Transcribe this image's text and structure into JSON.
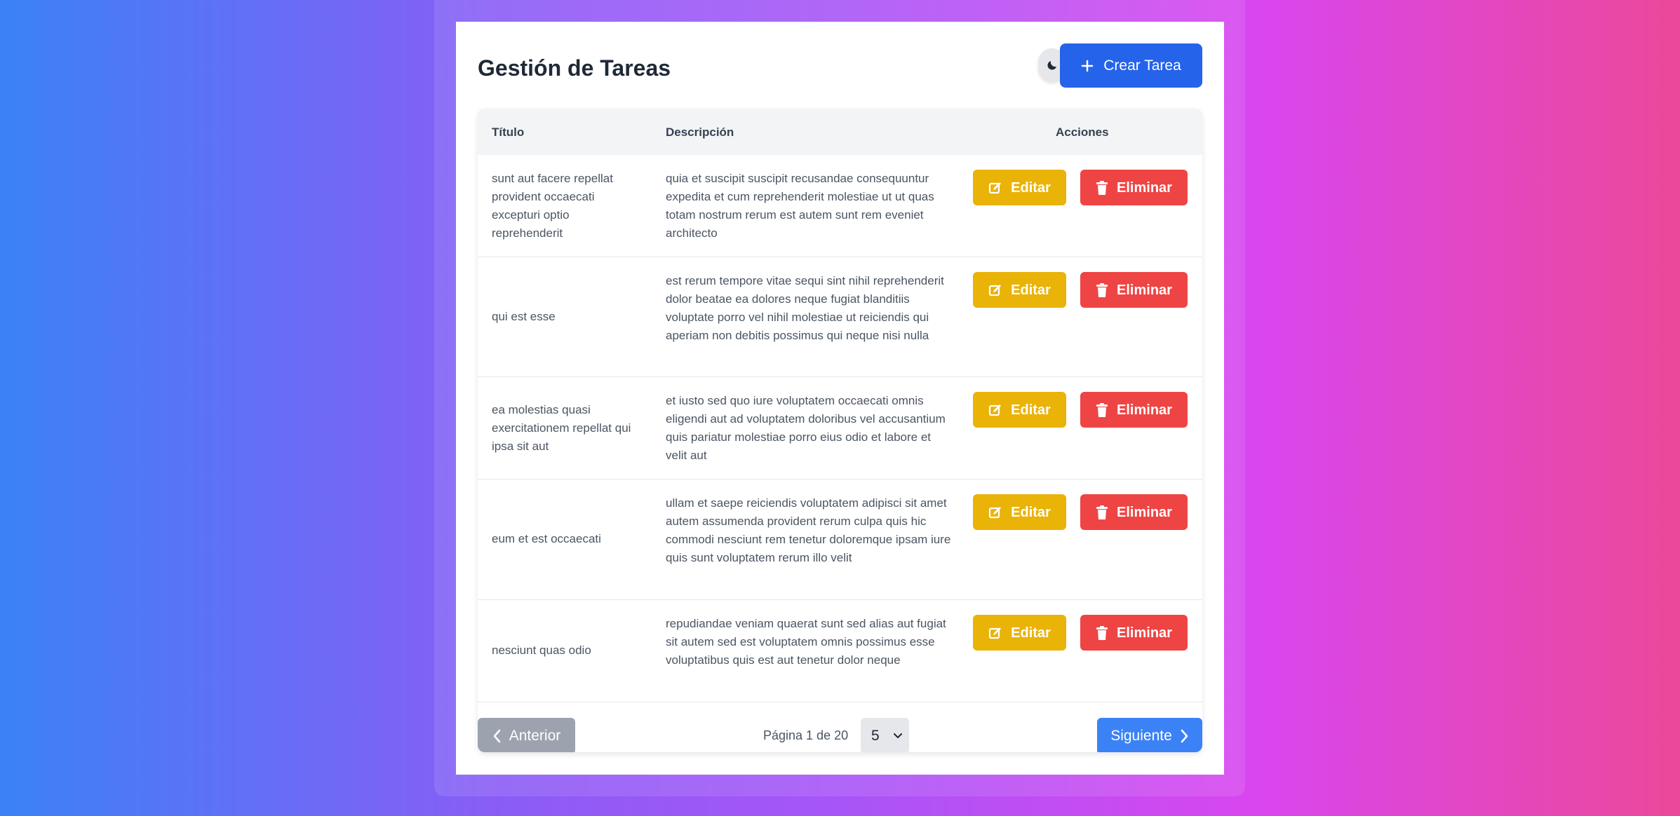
{
  "app": {
    "title": "Gestión de Tareas",
    "create_label": "Crear Tarea",
    "theme_icon": "moon-icon"
  },
  "table": {
    "headers": {
      "title": "Título",
      "description": "Descripción",
      "actions": "Acciones"
    },
    "edit_label": "Editar",
    "delete_label": "Eliminar",
    "rows": [
      {
        "title": "sunt aut facere repellat provident occaecati excepturi optio reprehenderit",
        "description": "quia et suscipit suscipit recusandae consequuntur expedita et cum reprehenderit molestiae ut ut quas totam nostrum rerum est autem sunt rem eveniet architecto"
      },
      {
        "title": "qui est esse",
        "description": "est rerum tempore vitae sequi sint nihil reprehenderit dolor beatae ea dolores neque fugiat blanditiis voluptate porro vel nihil molestiae ut reiciendis qui aperiam non debitis possimus qui neque nisi nulla"
      },
      {
        "title": "ea molestias quasi exercitationem repellat qui ipsa sit aut",
        "description": "et iusto sed quo iure voluptatem occaecati omnis eligendi aut ad voluptatem doloribus vel accusantium quis pariatur molestiae porro eius odio et labore et velit aut"
      },
      {
        "title": "eum et est occaecati",
        "description": "ullam et saepe reiciendis voluptatem adipisci sit amet autem assumenda provident rerum culpa quis hic commodi nesciunt rem tenetur doloremque ipsam iure quis sunt voluptatem rerum illo velit"
      },
      {
        "title": "nesciunt quas odio",
        "description": "repudiandae veniam quaerat sunt sed alias aut fugiat sit autem sed est voluptatem omnis possimus esse voluptatibus quis est aut tenetur dolor neque"
      }
    ]
  },
  "pagination": {
    "prev_label": "Anterior",
    "next_label": "Siguiente",
    "page_info": "Página 1 de 20",
    "page_size": "5"
  },
  "colors": {
    "primary": "#2563eb",
    "edit": "#eab308",
    "delete": "#ef4444",
    "next": "#3b82f6",
    "prev": "#9ca3af"
  }
}
